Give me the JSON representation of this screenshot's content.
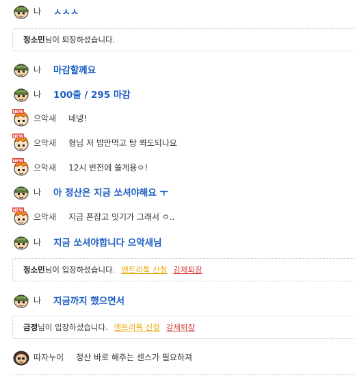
{
  "me_label": "나",
  "chat": {
    "r1": {
      "sender": "나",
      "text": "ㅅㅅㅅ"
    },
    "n1": {
      "name": "정소민",
      "text": "님이 퇴장하셨습니다."
    },
    "r2": {
      "sender": "나",
      "text": "마감할께요"
    },
    "r3": {
      "sender": "나",
      "text": "100출 / 295 마감"
    },
    "r4": {
      "sender": "으악새",
      "text": "네넹!"
    },
    "r5": {
      "sender": "으악새",
      "text": "형님 저 밥만먹고 탕 쫘도되나요"
    },
    "r6": {
      "sender": "으악새",
      "text": "12시 반전에 쏠게용ㅇ!"
    },
    "r7": {
      "sender": "나",
      "text": "아 정산은 지금 쏘셔야해요 ㅜ"
    },
    "r8": {
      "sender": "으악새",
      "text": "지금 폰잡고 잇기가 그래서 ㅇ.."
    },
    "r9": {
      "sender": "나",
      "text": "지금 쏘셔야합니다 으악새님"
    },
    "n2": {
      "name": "정소민",
      "text": "님이 입장하셨습니다.",
      "link1": "엔트리톡 신청",
      "link2": "강제퇴장"
    },
    "r10": {
      "sender": "나",
      "text": "지금까지 했으면서"
    },
    "n3": {
      "name": "금정",
      "text": "님이 입장하셨습니다.",
      "link1": "엔트리톡 신청",
      "link2": "강제퇴장"
    },
    "r11": {
      "sender": "따자누이",
      "text": "정산 바로 해주는 센스가 필요하져"
    }
  },
  "colors": {
    "mine_text": "#1a5dc2",
    "link_yellow": "#e8a600",
    "link_red": "#d63b3b"
  },
  "badge_new": "NEW"
}
